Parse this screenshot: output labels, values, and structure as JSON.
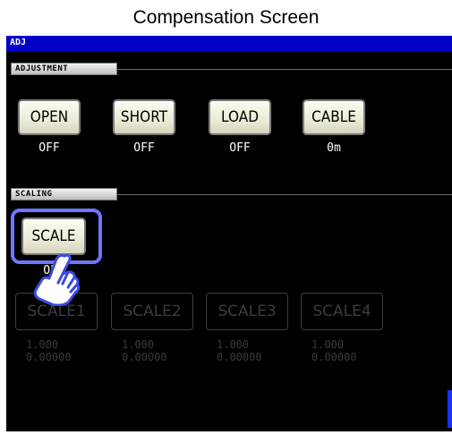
{
  "caption": "Compensation Screen",
  "screen": {
    "title": "ADJ",
    "adjustment": {
      "label": "ADJUSTMENT",
      "buttons": [
        {
          "label": "OPEN",
          "value": "OFF"
        },
        {
          "label": "SHORT",
          "value": "OFF"
        },
        {
          "label": "LOAD",
          "value": "OFF"
        },
        {
          "label": "CABLE",
          "value": "0m"
        }
      ]
    },
    "scaling": {
      "label": "SCALING",
      "scale_button": "SCALE",
      "scale_value": "OFF",
      "disabled_buttons": [
        {
          "label": "SCALE1",
          "a": "1.000",
          "b": "0.00000"
        },
        {
          "label": "SCALE2",
          "a": "1.000",
          "b": "0.00000"
        },
        {
          "label": "SCALE3",
          "a": "1.000",
          "b": "0.00000"
        },
        {
          "label": "SCALE4",
          "a": "1.000",
          "b": "0.00000"
        }
      ]
    },
    "colors": {
      "title_bar": "#0000c8",
      "highlight": "#6e76ff",
      "background": "#000000"
    }
  }
}
